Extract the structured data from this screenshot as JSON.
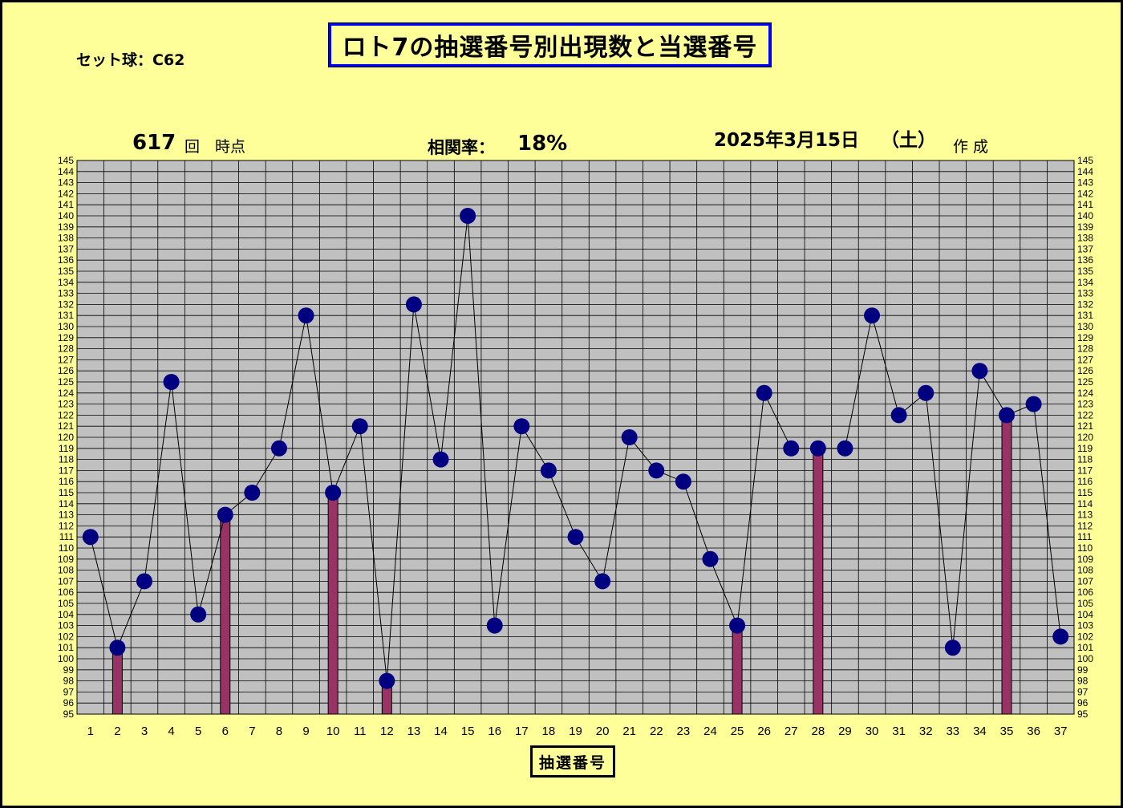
{
  "title": "ロト7の抽選番号別出現数と当選番号",
  "set_ball": "セット球：C62",
  "draw": {
    "count": "617",
    "unit": "回",
    "suffix": "時点"
  },
  "correlation": {
    "label": "相関率：",
    "value": "18%"
  },
  "date": {
    "text": "2025年3月15日",
    "weekday": "（土）",
    "made": "作 成"
  },
  "chart_data": {
    "type": "line",
    "xlabel": "抽選番号",
    "ylabel": "",
    "ylim": [
      95,
      145
    ],
    "grid": true,
    "x": [
      1,
      2,
      3,
      4,
      5,
      6,
      7,
      8,
      9,
      10,
      11,
      12,
      13,
      14,
      15,
      16,
      17,
      18,
      19,
      20,
      21,
      22,
      23,
      24,
      25,
      26,
      27,
      28,
      29,
      30,
      31,
      32,
      33,
      34,
      35,
      36,
      37
    ],
    "series": [
      {
        "values": [
          111,
          101,
          107,
          125,
          104,
          113,
          115,
          119,
          131,
          115,
          121,
          98,
          132,
          118,
          140,
          103,
          121,
          117,
          111,
          107,
          120,
          117,
          116,
          109,
          103,
          124,
          119,
          119,
          119,
          131,
          122,
          124,
          101,
          126,
          122,
          123,
          102
        ]
      }
    ],
    "winning_numbers": [
      2,
      6,
      10,
      12,
      25,
      28,
      35
    ],
    "colors": {
      "line": "#000000",
      "marker": "#000080",
      "bar": "#993366",
      "plot_bg": "#c0c0c0",
      "grid": "#000000"
    }
  }
}
